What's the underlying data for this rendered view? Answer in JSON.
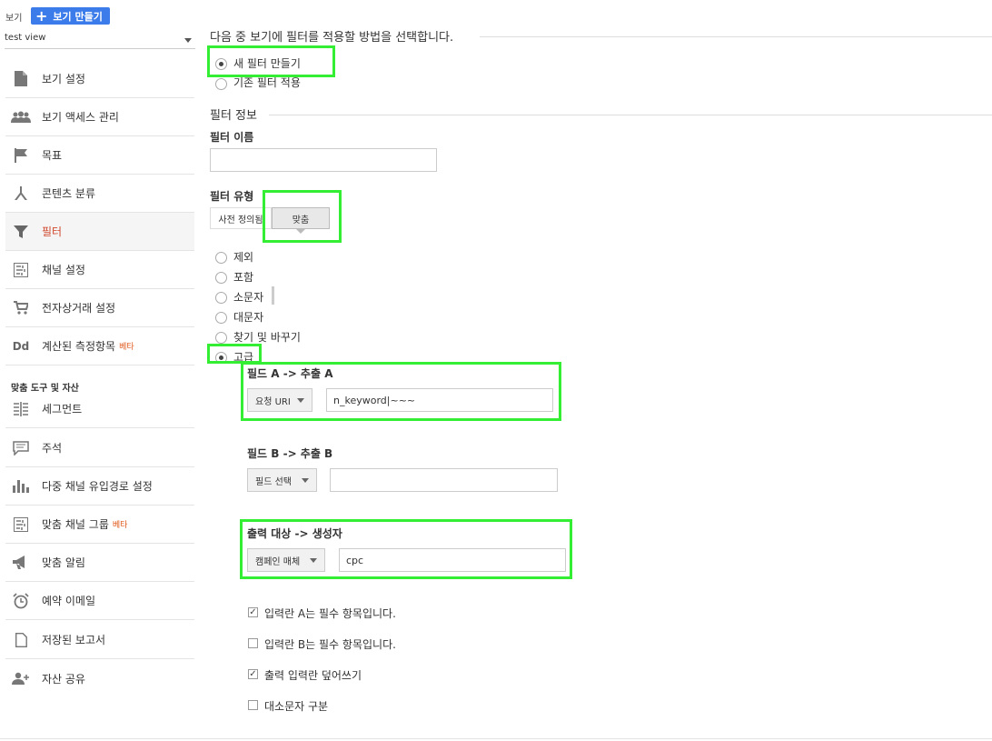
{
  "sidebar": {
    "view_label": "보기",
    "create_view_label": "보기 만들기",
    "selected_view": "test view",
    "items": [
      {
        "label": "보기 설정",
        "icon": "document-icon"
      },
      {
        "label": "보기 액세스 관리",
        "icon": "people-icon"
      },
      {
        "label": "목표",
        "icon": "flag-icon"
      },
      {
        "label": "콘텐츠 분류",
        "icon": "content-grouping-icon"
      },
      {
        "label": "필터",
        "icon": "filter-icon"
      },
      {
        "label": "채널 설정",
        "icon": "channel-settings-icon"
      },
      {
        "label": "전자상거래 설정",
        "icon": "cart-icon"
      },
      {
        "label": "계산된 측정항목",
        "icon": "dd-icon",
        "badge": "베타"
      }
    ],
    "section_header": "맞춤 도구 및 자산",
    "tools": [
      {
        "label": "세그먼트",
        "icon": "segment-icon"
      },
      {
        "label": "주석",
        "icon": "comment-icon"
      },
      {
        "label": "다중 채널 유입경로 설정",
        "icon": "bar-chart-icon"
      },
      {
        "label": "맞춤 채널 그룹",
        "icon": "channel-group-icon",
        "badge": "베타"
      },
      {
        "label": "맞춤 알림",
        "icon": "megaphone-icon"
      },
      {
        "label": "예약 이메일",
        "icon": "alarm-clock-icon"
      },
      {
        "label": "저장된 보고서",
        "icon": "saved-report-icon"
      },
      {
        "label": "자산 공유",
        "icon": "add-person-icon"
      }
    ],
    "dd_glyph": "Dd"
  },
  "main": {
    "title": "다음 중 보기에 필터를 적용할 방법을 선택합니다.",
    "apply_options": [
      "새 필터 만들기",
      "기존 필터 적용"
    ],
    "filter_info_header": "필터 정보",
    "filter_name_label": "필터 이름",
    "filter_name_value": "",
    "filter_type_label": "필터 유형",
    "type_tabs": [
      "사전 정의됨",
      "맞춤"
    ],
    "custom_options": [
      "제외",
      "포함",
      "소문자",
      "대문자",
      "찾기 및 바꾸기",
      "고급"
    ],
    "field_a_label": "필드 A -> 추출 A",
    "field_a_select": "요청 URI",
    "field_a_value": "n_keyword|~~~",
    "field_b_label": "필드 B -> 추출 B",
    "field_b_select": "필드 선택",
    "field_b_value": "",
    "output_label": "출력 대상 -> 생성자",
    "output_select": "캠페인 매체",
    "output_value": "cpc",
    "checkboxes": [
      {
        "label": "입력란 A는 필수 항목입니다.",
        "checked": true
      },
      {
        "label": "입력란 B는 필수 항목입니다.",
        "checked": false
      },
      {
        "label": "출력 입력란 덮어쓰기",
        "checked": true
      },
      {
        "label": "대소문자 구분",
        "checked": false
      }
    ],
    "check_glyph": "✓"
  },
  "colors": {
    "accent": "#3b7bea",
    "highlight": "#33ee33",
    "active_nav": "#d0452a",
    "beta": "#e0571b"
  }
}
